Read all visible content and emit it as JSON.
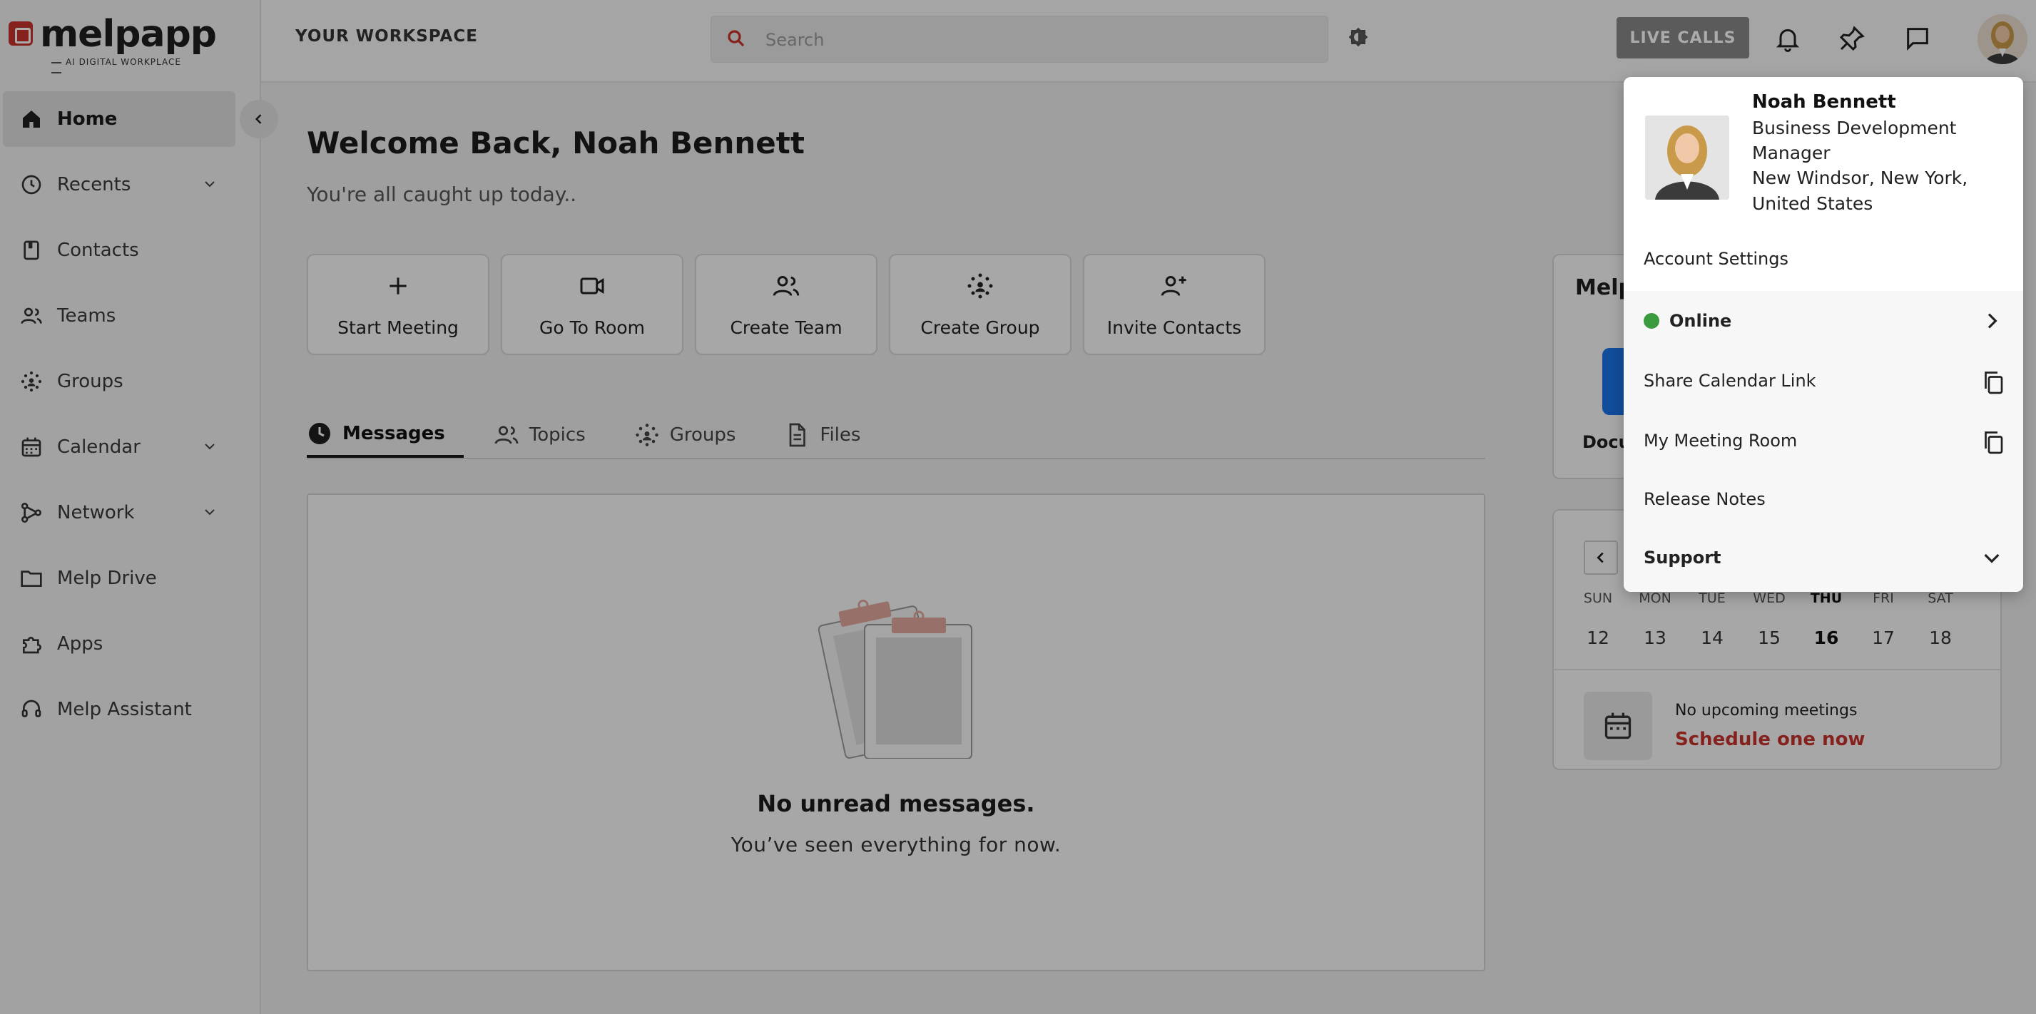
{
  "brand": {
    "name": "melpapp",
    "tagline": "AI DIGITAL WORKPLACE"
  },
  "sidebar": {
    "items": [
      {
        "label": "Home",
        "icon": "home-icon",
        "active": true,
        "expandable": false
      },
      {
        "label": "Recents",
        "icon": "clock-icon",
        "expandable": true
      },
      {
        "label": "Contacts",
        "icon": "contacts-icon",
        "expandable": false
      },
      {
        "label": "Teams",
        "icon": "teams-icon",
        "expandable": false
      },
      {
        "label": "Groups",
        "icon": "groups-icon",
        "expandable": false
      },
      {
        "label": "Calendar",
        "icon": "calendar-icon",
        "expandable": true
      },
      {
        "label": "Network",
        "icon": "network-icon",
        "expandable": true
      },
      {
        "label": "Melp Drive",
        "icon": "folder-icon",
        "expandable": false
      },
      {
        "label": "Apps",
        "icon": "puzzle-icon",
        "expandable": false
      },
      {
        "label": "Melp Assistant",
        "icon": "headset-icon",
        "expandable": false
      }
    ]
  },
  "header": {
    "workspace": "YOUR WORKSPACE",
    "search_placeholder": "Search",
    "live_calls": "LIVE CALLS"
  },
  "main": {
    "welcome": "Welcome Back, Noah Bennett",
    "subtitle": "You're all caught up today..",
    "actions": [
      "Start Meeting",
      "Go To Room",
      "Create Team",
      "Create Group",
      "Invite Contacts"
    ],
    "tabs": [
      "Messages",
      "Topics",
      "Groups",
      "Files"
    ],
    "empty_title": "No unread messages.",
    "empty_subtitle": "You’ve seen everything for now."
  },
  "right": {
    "card_title": "Melp",
    "card_label": "Docu",
    "calendar": {
      "days": [
        "SUN",
        "MON",
        "TUE",
        "WED",
        "THU",
        "FRI",
        "SAT"
      ],
      "dates": [
        "12",
        "13",
        "14",
        "15",
        "16",
        "17",
        "18"
      ],
      "today_index": 4,
      "no_meetings": "No upcoming meetings",
      "schedule": "Schedule one now"
    }
  },
  "profile_menu": {
    "name": "Noah Bennett",
    "role": "Business Development Manager",
    "location": "New Windsor, New York, United States",
    "items": {
      "account": "Account Settings",
      "status": "Online",
      "calendar_link": "Share Calendar Link",
      "meeting_room": "My Meeting Room",
      "release_notes": "Release Notes",
      "support": "Support"
    }
  },
  "colors": {
    "brand_red": "#c8332e",
    "online_green": "#3a9a3e",
    "link_red": "#c8332e"
  }
}
